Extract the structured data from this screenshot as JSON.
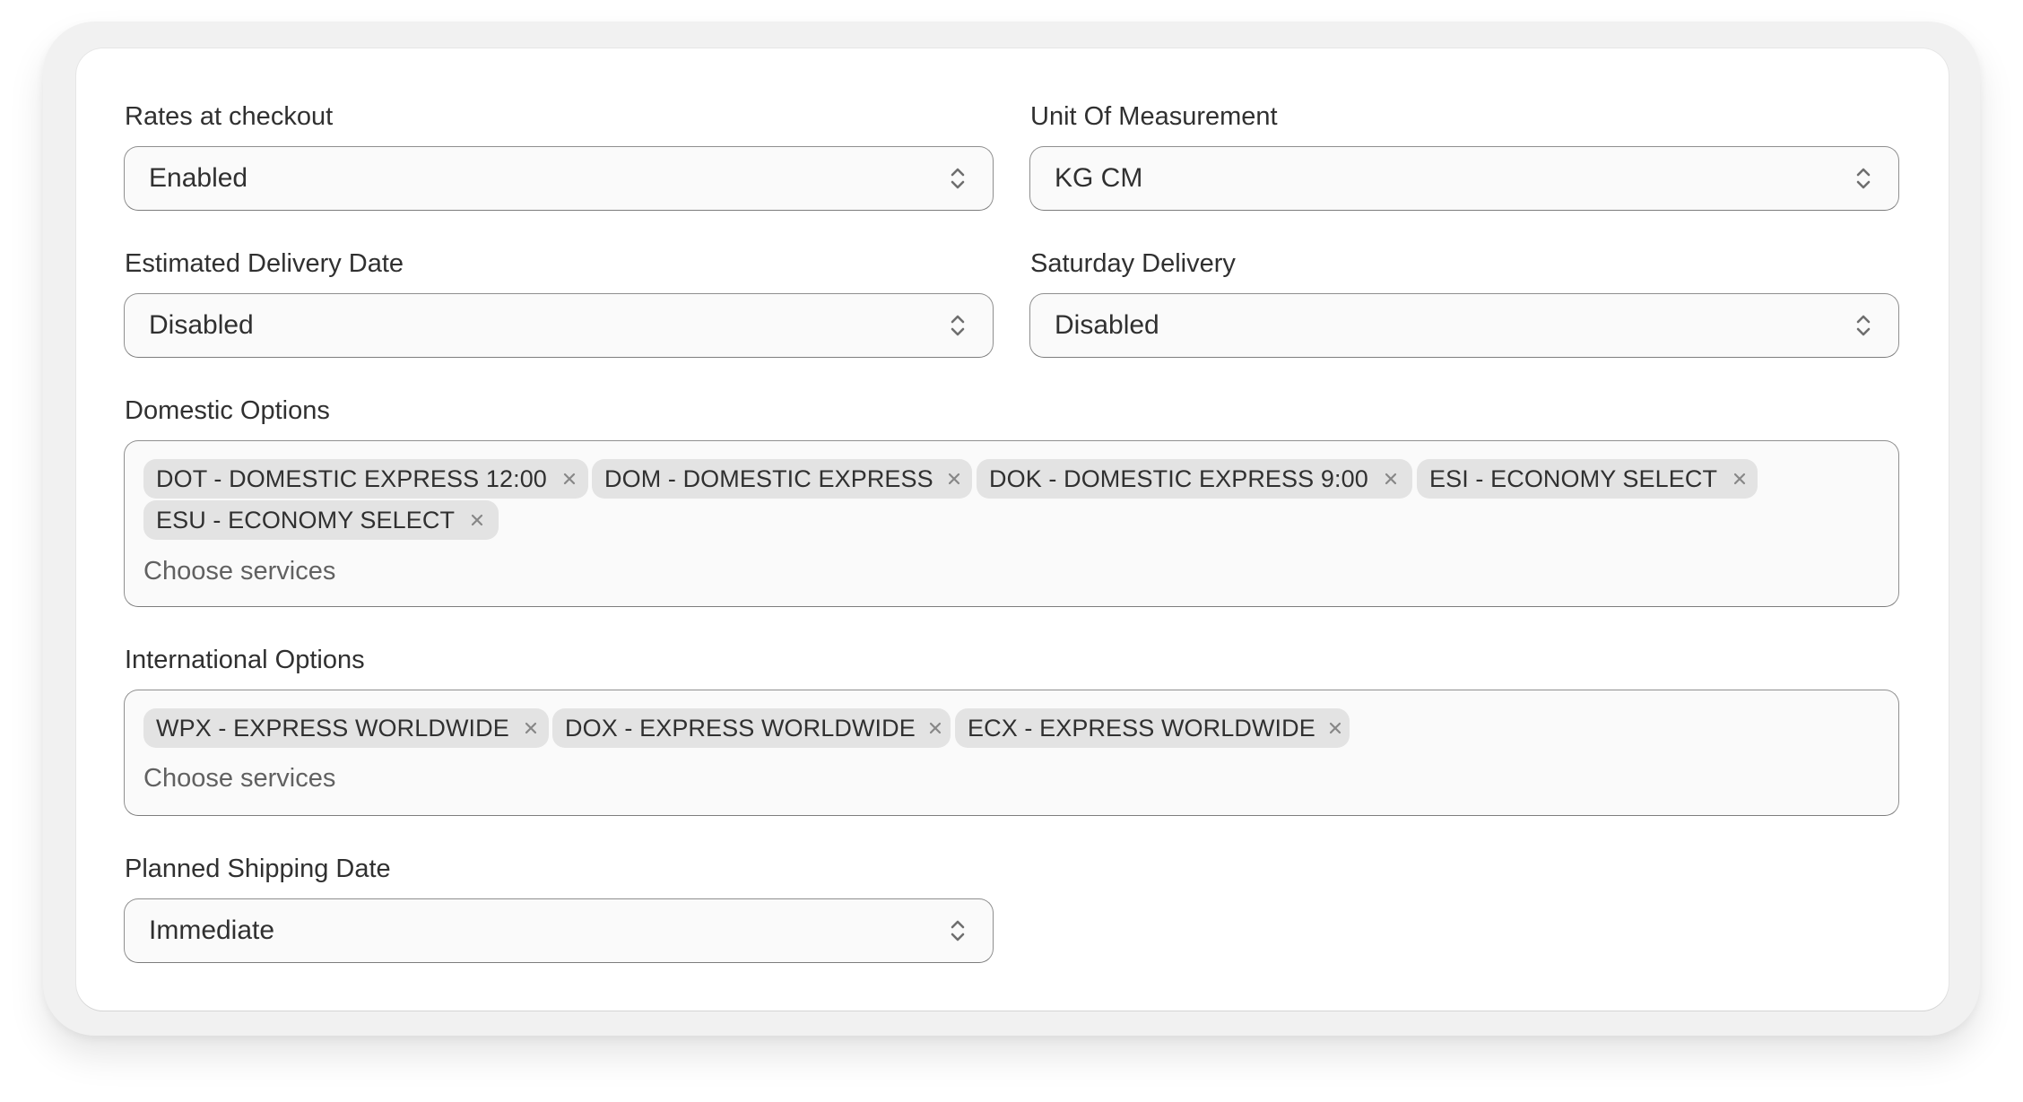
{
  "fields": {
    "rates_at_checkout": {
      "label": "Rates at checkout",
      "value": "Enabled"
    },
    "unit_of_measurement": {
      "label": "Unit Of Measurement",
      "value": "KG CM"
    },
    "estimated_delivery_date": {
      "label": "Estimated Delivery Date",
      "value": "Disabled"
    },
    "saturday_delivery": {
      "label": "Saturday Delivery",
      "value": "Disabled"
    },
    "planned_shipping_date": {
      "label": "Planned Shipping Date",
      "value": "Immediate"
    }
  },
  "domestic_options": {
    "label": "Domestic Options",
    "placeholder": "Choose services",
    "chips": [
      "DOT - DOMESTIC EXPRESS 12:00",
      "DOM - DOMESTIC EXPRESS",
      "DOK - DOMESTIC EXPRESS 9:00",
      "ESI - ECONOMY SELECT",
      "ESU - ECONOMY SELECT"
    ]
  },
  "international_options": {
    "label": "International Options",
    "placeholder": "Choose services",
    "chips": [
      "WPX - EXPRESS WORLDWIDE",
      "DOX - EXPRESS WORLDWIDE",
      "ECX - EXPRESS WORLDWIDE"
    ]
  },
  "icons": {
    "select_indicator": "chevron-up-down-icon",
    "chip_remove": "close-x-icon"
  },
  "colors": {
    "chip_background": "#e3e3e3",
    "field_background": "#fafafa",
    "field_border": "#8f8f8f",
    "text": "#303030",
    "placeholder": "#616161"
  }
}
